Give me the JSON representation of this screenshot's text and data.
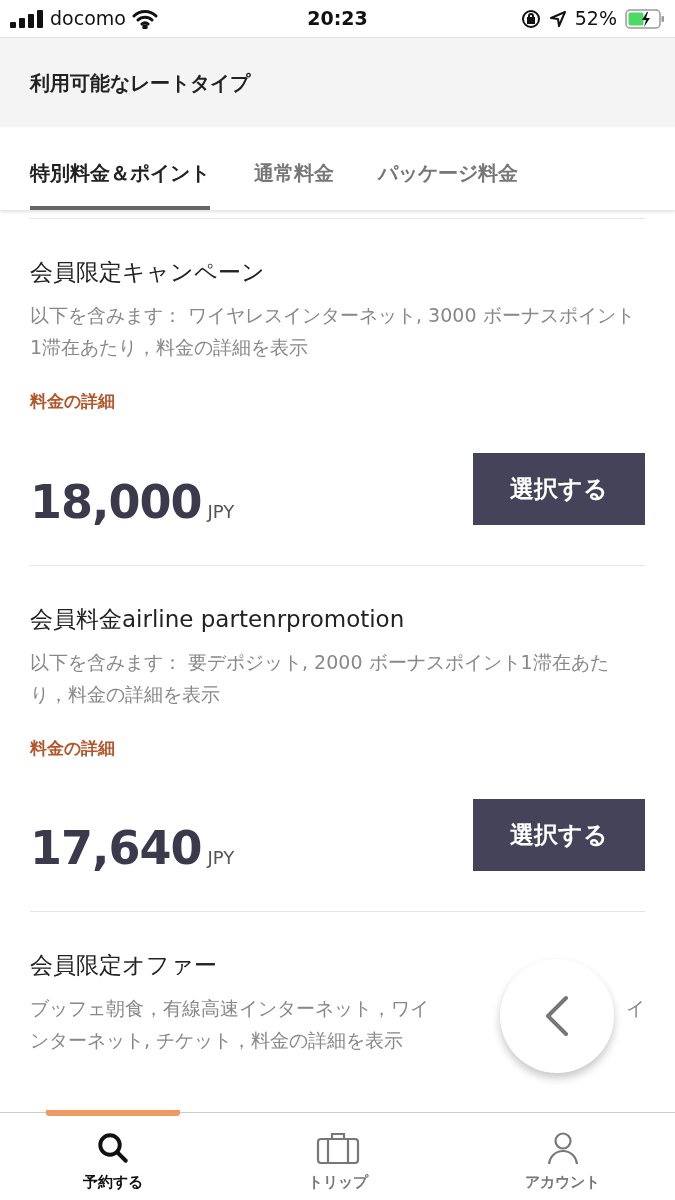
{
  "status_bar": {
    "carrier": "docomo",
    "time": "20:23",
    "battery": "52%"
  },
  "header": {
    "title": "利用可能なレートタイプ"
  },
  "tabs": [
    {
      "label": "特別料金＆ポイント",
      "selected": true
    },
    {
      "label": "通常料金",
      "selected": false
    },
    {
      "label": "パッケージ料金",
      "selected": false
    }
  ],
  "rates": [
    {
      "title": "会員限定キャンペーン",
      "description": "以下を含みます：  ワイヤレスインターネット, 3000 ボーナスポイント1滞在あたり，料金の詳細を表示",
      "detail_link": "料金の詳細",
      "price": "18,000",
      "currency": "JPY",
      "button": "選択する"
    },
    {
      "title": "会員料金airline partenrpromotion",
      "description": "以下を含みます：  要デポジット, 2000 ボーナスポイント1滞在あたり，料金の詳細を表示",
      "detail_link": "料金の詳細",
      "price": "17,640",
      "currency": "JPY",
      "button": "選択する"
    },
    {
      "title": "会員限定オファー",
      "description_visible": [
        [
          "ブッフェ朝食，有線高速インターネット，ワイ",
          "イ"
        ],
        [
          "ンターネット, チケット，料金の詳細を表示"
        ]
      ]
    }
  ],
  "bottom_nav": [
    {
      "kind": "search",
      "label": "予約する",
      "selected": true
    },
    {
      "kind": "trip",
      "label": "トリップ",
      "selected": false
    },
    {
      "kind": "account",
      "label": "アカウント",
      "selected": false
    }
  ]
}
